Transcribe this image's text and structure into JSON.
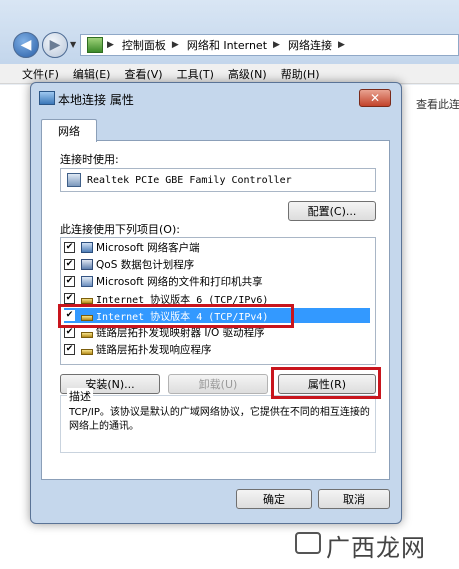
{
  "explorer": {
    "breadcrumb": [
      "控制面板",
      "网络和 Internet",
      "网络连接"
    ],
    "menus": [
      "文件(F)",
      "编辑(E)",
      "查看(V)",
      "工具(T)",
      "高级(N)",
      "帮助(H)"
    ],
    "view_status": "查看此连"
  },
  "dialog": {
    "title": "本地连接 属性",
    "close_glyph": "✕",
    "tab": "网络",
    "connect_using_label": "连接时使用:",
    "adapter_name": "Realtek PCIe GBE Family Controller",
    "configure_button": "配置(C)...",
    "items_label": "此连接使用下列项目(O):",
    "items": [
      {
        "label": "Microsoft 网络客户端",
        "checked": true,
        "icon": "network-client-icon"
      },
      {
        "label": "QoS 数据包计划程序",
        "checked": true,
        "icon": "qos-icon"
      },
      {
        "label": "Microsoft 网络的文件和打印机共享",
        "checked": true,
        "icon": "file-share-icon"
      },
      {
        "label": "Internet 协议版本 6 (TCP/IPv6)",
        "checked": true,
        "icon": "protocol-icon"
      },
      {
        "label": "Internet 协议版本 4 (TCP/IPv4)",
        "checked": true,
        "icon": "protocol-icon",
        "selected": true
      },
      {
        "label": "链路层拓扑发现映射器 I/O 驱动程序",
        "checked": true,
        "icon": "protocol-icon"
      },
      {
        "label": "链路层拓扑发现响应程序",
        "checked": true,
        "icon": "protocol-icon"
      }
    ],
    "install_button": "安装(N)...",
    "uninstall_button": "卸载(U)",
    "properties_button": "属性(R)",
    "description_title": "描述",
    "description_text": "TCP/IP。该协议是默认的广域网络协议，它提供在不同的相互连接的网络上的通讯。",
    "ok_button": "确定",
    "cancel_button": "取消"
  },
  "watermark": "广西龙网",
  "colors": {
    "selection": "#3399ff",
    "highlight_box": "#c8151d",
    "dialog_frame": "#c5d7ec"
  }
}
